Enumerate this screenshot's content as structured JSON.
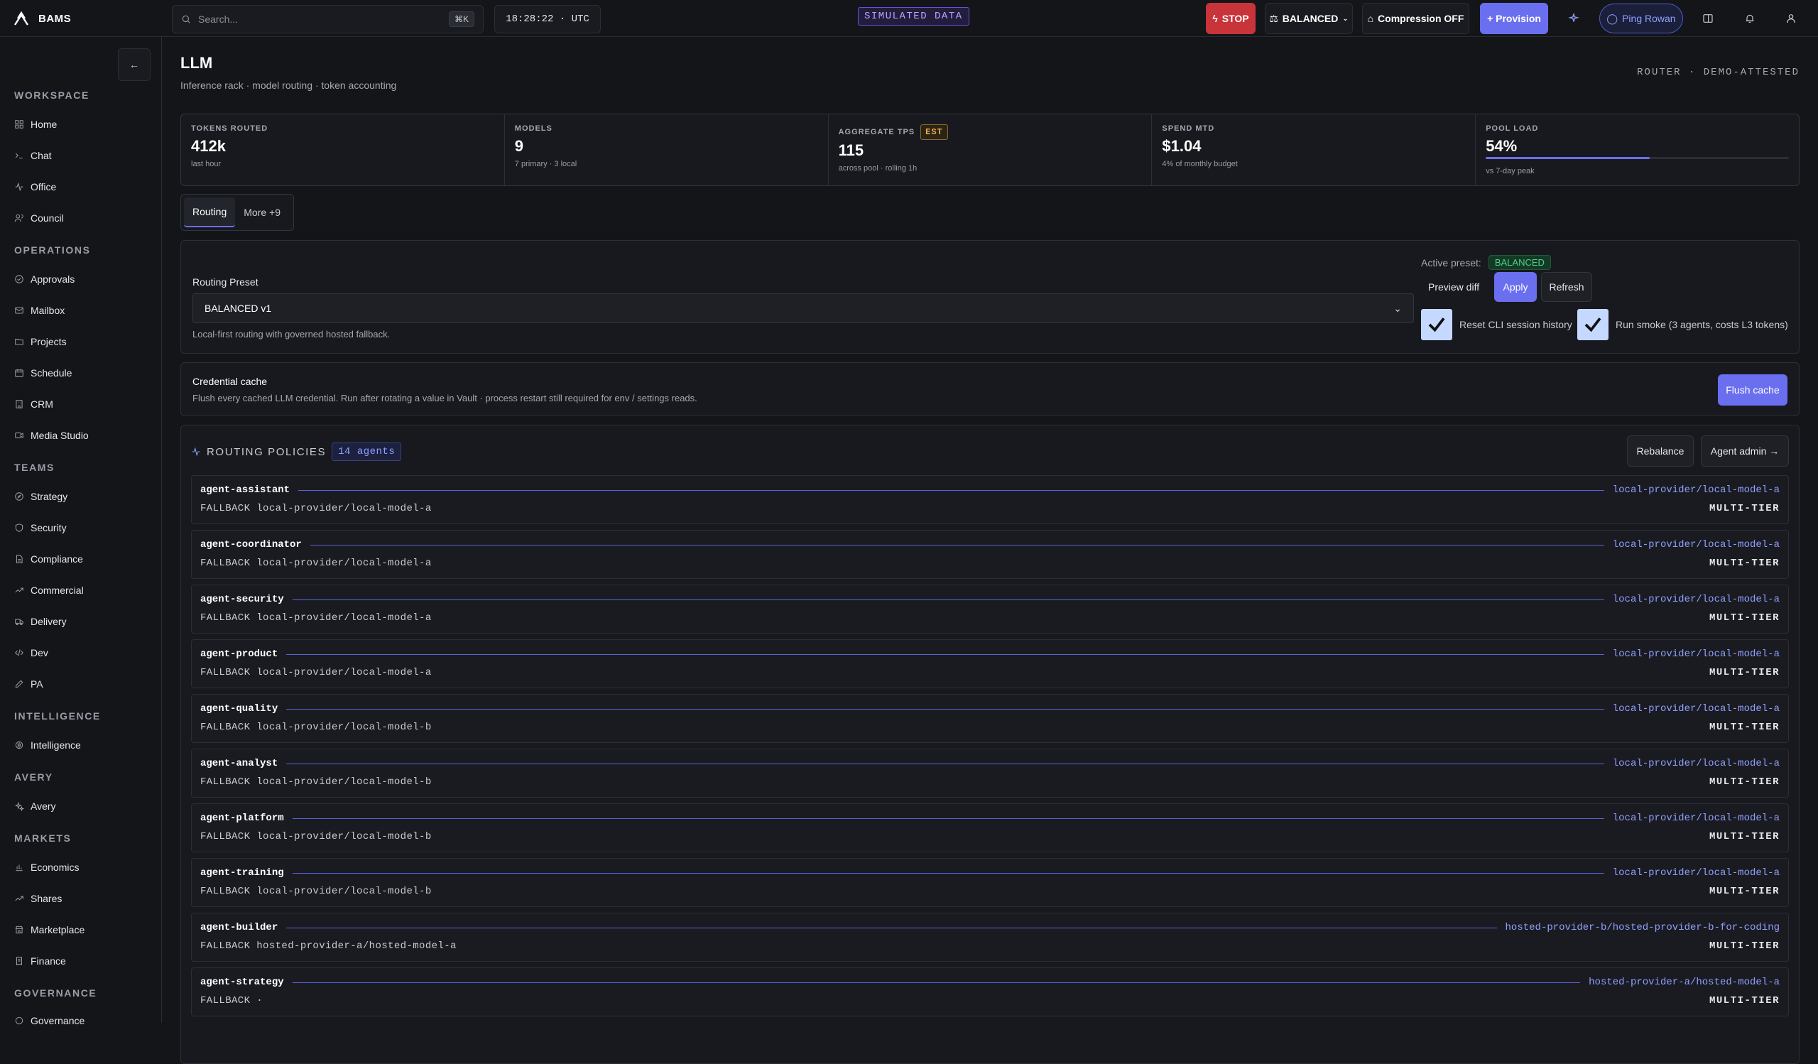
{
  "app": {
    "name": "BAMS"
  },
  "topbar": {
    "search_placeholder": "Search...",
    "search_shortcut": "⌘K",
    "clock": "18:28:22 · UTC",
    "simulated": "SIMULATED DATA",
    "stop_label": "STOP",
    "preset_label": "BALANCED",
    "compression_label": "Compression OFF",
    "provision_label": "+ Provision",
    "ping_label": "Ping Rowan",
    "colors": {
      "stop": "#c9333a",
      "accent": "#6a6ff0"
    }
  },
  "sidebar": {
    "sections": [
      {
        "title": "WORKSPACE",
        "items": [
          {
            "label": "Home",
            "icon": "grid-icon"
          },
          {
            "label": "Chat",
            "icon": "terminal-icon"
          },
          {
            "label": "Office",
            "icon": "activity-icon"
          },
          {
            "label": "Council",
            "icon": "users-icon"
          }
        ]
      },
      {
        "title": "OPERATIONS",
        "items": [
          {
            "label": "Approvals",
            "icon": "check-circle-icon"
          },
          {
            "label": "Mailbox",
            "icon": "mail-icon"
          },
          {
            "label": "Projects",
            "icon": "folder-icon"
          },
          {
            "label": "Schedule",
            "icon": "calendar-icon"
          },
          {
            "label": "CRM",
            "icon": "building-icon"
          },
          {
            "label": "Media Studio",
            "icon": "video-icon"
          }
        ]
      },
      {
        "title": "TEAMS",
        "items": [
          {
            "label": "Strategy",
            "icon": "compass-icon"
          },
          {
            "label": "Security",
            "icon": "shield-icon"
          },
          {
            "label": "Compliance",
            "icon": "file-icon"
          },
          {
            "label": "Commercial",
            "icon": "trending-up-icon"
          },
          {
            "label": "Delivery",
            "icon": "truck-icon"
          },
          {
            "label": "Dev",
            "icon": "code-icon"
          },
          {
            "label": "PA",
            "icon": "pen-icon"
          }
        ]
      },
      {
        "title": "INTELLIGENCE",
        "items": [
          {
            "label": "Intelligence",
            "icon": "brain-icon"
          }
        ]
      },
      {
        "title": "AVERY",
        "items": [
          {
            "label": "Avery",
            "icon": "sparkles-icon"
          }
        ]
      },
      {
        "title": "MARKETS",
        "items": [
          {
            "label": "Economics",
            "icon": "bar-chart-icon"
          },
          {
            "label": "Shares",
            "icon": "trending-up-icon"
          },
          {
            "label": "Marketplace",
            "icon": "store-icon"
          },
          {
            "label": "Finance",
            "icon": "receipt-icon"
          }
        ]
      },
      {
        "title": "GOVERNANCE",
        "items": [
          {
            "label": "Governance",
            "icon": "landmark-icon"
          }
        ]
      }
    ]
  },
  "page": {
    "title": "LLM",
    "subtitle": "Inference rack · model routing · token accounting",
    "router_tag": "ROUTER · DEMO-ATTESTED"
  },
  "stats": [
    {
      "label": "TOKENS ROUTED",
      "value": "412k",
      "note": "last hour"
    },
    {
      "label": "MODELS",
      "value": "9",
      "note": "7 primary · 3 local"
    },
    {
      "label": "AGGREGATE TPS",
      "badge": "EST",
      "value": "115",
      "note": "across pool · rolling 1h"
    },
    {
      "label": "SPEND MTD",
      "value": "$1.04",
      "note": "4% of monthly budget"
    },
    {
      "label": "POOL LOAD",
      "value": "54%",
      "note": "vs 7-day peak",
      "progress": 0.54
    }
  ],
  "tabs": [
    {
      "label": "Routing",
      "active": true
    },
    {
      "label": "More +9",
      "active": false
    }
  ],
  "routing": {
    "label": "Routing Preset",
    "selected": "BALANCED v1",
    "hint": "Local-first routing with governed hosted fallback.",
    "active_preset_label": "Active preset:",
    "active_preset": "BALANCED",
    "preview_label": "Preview diff",
    "apply_label": "Apply",
    "refresh_label": "Refresh",
    "checks": [
      {
        "label": "Reset CLI session history",
        "checked": true
      },
      {
        "label": "Run smoke (3 agents, costs L3 tokens)",
        "checked": true
      }
    ]
  },
  "credential": {
    "title": "Credential cache",
    "description": "Flush every cached LLM credential. Run after rotating a value in Vault · process restart still required for env / settings reads.",
    "button": "Flush cache"
  },
  "policies": {
    "title": "ROUTING POLICIES",
    "count_badge": "14 agents",
    "rebalance_label": "Rebalance",
    "agent_admin_label": "Agent admin →",
    "rows": [
      {
        "agent": "agent-assistant",
        "primary": "local-provider/local-model-a",
        "fallback": "FALLBACK local-provider/local-model-a",
        "tier": "MULTI-TIER"
      },
      {
        "agent": "agent-coordinator",
        "primary": "local-provider/local-model-a",
        "fallback": "FALLBACK local-provider/local-model-a",
        "tier": "MULTI-TIER"
      },
      {
        "agent": "agent-security",
        "primary": "local-provider/local-model-a",
        "fallback": "FALLBACK local-provider/local-model-a",
        "tier": "MULTI-TIER"
      },
      {
        "agent": "agent-product",
        "primary": "local-provider/local-model-a",
        "fallback": "FALLBACK local-provider/local-model-a",
        "tier": "MULTI-TIER"
      },
      {
        "agent": "agent-quality",
        "primary": "local-provider/local-model-a",
        "fallback": "FALLBACK local-provider/local-model-b",
        "tier": "MULTI-TIER"
      },
      {
        "agent": "agent-analyst",
        "primary": "local-provider/local-model-a",
        "fallback": "FALLBACK local-provider/local-model-b",
        "tier": "MULTI-TIER"
      },
      {
        "agent": "agent-platform",
        "primary": "local-provider/local-model-a",
        "fallback": "FALLBACK local-provider/local-model-b",
        "tier": "MULTI-TIER"
      },
      {
        "agent": "agent-training",
        "primary": "local-provider/local-model-a",
        "fallback": "FALLBACK local-provider/local-model-b",
        "tier": "MULTI-TIER"
      },
      {
        "agent": "agent-builder",
        "primary": "hosted-provider-b/hosted-provider-b-for-coding",
        "fallback": "FALLBACK hosted-provider-a/hosted-model-a",
        "tier": "MULTI-TIER"
      },
      {
        "agent": "agent-strategy",
        "primary": "hosted-provider-a/hosted-model-a",
        "fallback": "FALLBACK ·",
        "tier": "MULTI-TIER"
      }
    ]
  }
}
